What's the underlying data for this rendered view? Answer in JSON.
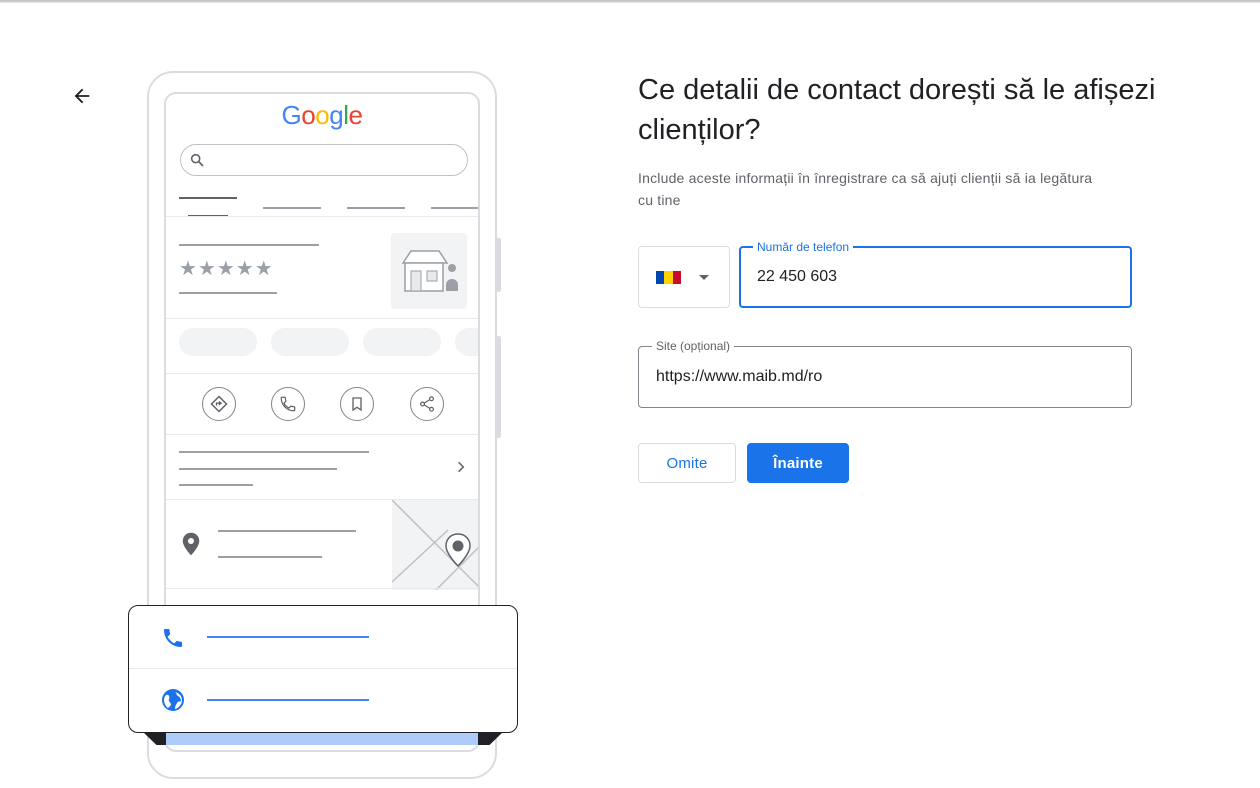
{
  "illustration": {
    "logo_letters": [
      "G",
      "o",
      "o",
      "g",
      "l",
      "e"
    ],
    "rating_stars": "★★★★★"
  },
  "heading": {
    "title": "Ce detalii de contact dorești să le afișezi clienților?",
    "subtitle": "Include aceste informații în înregistrare ca să ajuți clienții să ia legătura cu tine"
  },
  "form": {
    "country": {
      "flag_colors": [
        "#0046ae",
        "#ffd200",
        "#cc092f"
      ],
      "icon": "chevron-down-icon"
    },
    "phone": {
      "label": "Număr de telefon",
      "value": "22 450 603"
    },
    "website": {
      "label": "Site (opțional)",
      "value": "https://www.maib.md/ro"
    }
  },
  "actions": {
    "skip_label": "Omite",
    "next_label": "Înainte"
  },
  "colors": {
    "accent": "#1a73e8",
    "border": "#dadce0",
    "text": "#202124",
    "muted": "#5f6368"
  }
}
